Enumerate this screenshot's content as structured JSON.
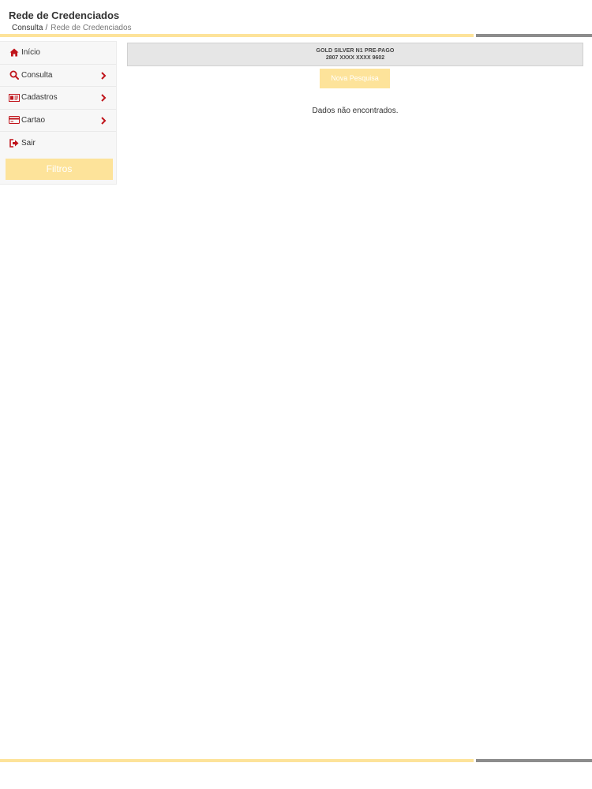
{
  "header": {
    "title": "Rede de Credenciados",
    "breadcrumb": {
      "parent": "Consulta",
      "separator": "/",
      "current": "Rede de Credenciados"
    }
  },
  "sidebar": {
    "items": [
      {
        "label": "Início",
        "icon": "home-icon",
        "has_submenu": false
      },
      {
        "label": "Consulta",
        "icon": "search-icon",
        "has_submenu": true
      },
      {
        "label": "Cadastros",
        "icon": "id-card-icon",
        "has_submenu": true
      },
      {
        "label": "Cartao",
        "icon": "credit-card-icon",
        "has_submenu": true
      },
      {
        "label": "Sair",
        "icon": "sign-out-icon",
        "has_submenu": false
      }
    ],
    "filter_button": "Filtros"
  },
  "card": {
    "name": "GOLD SILVER N1 PRE-PAGO",
    "number": "2807 XXXX XXXX 9602"
  },
  "search_button": "Nova Pesquisa",
  "empty_message": "Dados não encontrados.",
  "colors": {
    "accent_yellow": "#fde39a",
    "accent_gray": "#8c8c8c",
    "icon_red": "#c0141b",
    "banner_bg": "#e6e6e6"
  }
}
